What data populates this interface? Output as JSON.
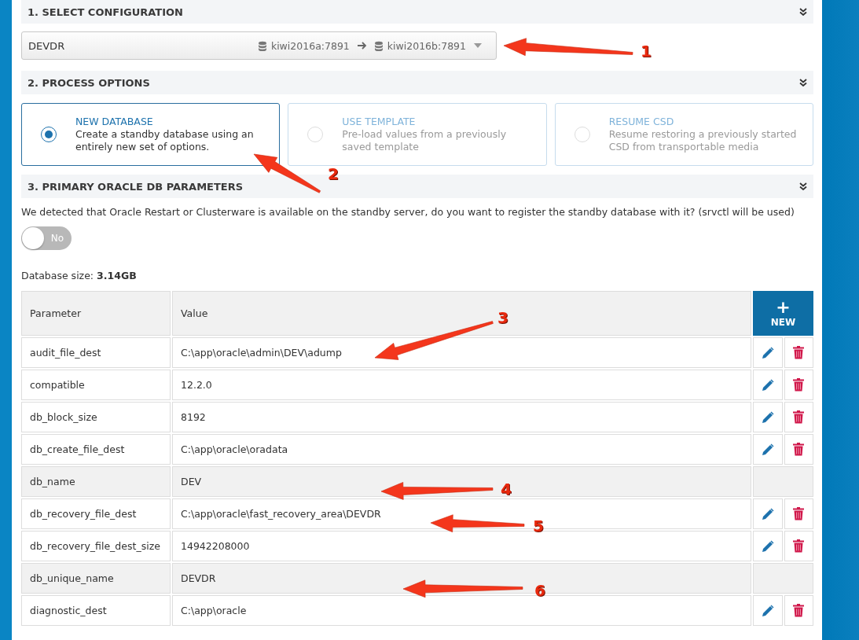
{
  "sections": [
    {
      "title": "1. SELECT CONFIGURATION",
      "expanded": true
    },
    {
      "title": "2. PROCESS OPTIONS",
      "expanded": true
    },
    {
      "title": "3. PRIMARY ORACLE DB PARAMETERS",
      "expanded": true
    }
  ],
  "configuration": {
    "value": "DEVDR",
    "source": "kiwi2016a:7891",
    "target": "kiwi2016b:7891"
  },
  "options": [
    {
      "title": "NEW DATABASE",
      "description": "Create a standby database using an entirely new set of options.",
      "selected": true,
      "disabled": false
    },
    {
      "title": "USE TEMPLATE",
      "description": "Pre-load values from a previously saved template",
      "selected": false,
      "disabled": true
    },
    {
      "title": "RESUME CSD",
      "description": "Resume restoring a previously started CSD from transportable media",
      "selected": false,
      "disabled": true
    }
  ],
  "clusterware_notice": "We detected that Oracle Restart or Clusterware is available on the standby server, do you want to register the standby database with it? (srvctl will be used)",
  "register_toggle": {
    "label": "No",
    "on": false
  },
  "database_size": {
    "label": "Database size:",
    "value": "3.14GB"
  },
  "table": {
    "columns": [
      "Parameter",
      "Value"
    ],
    "new_button": {
      "icon": "+",
      "label": "NEW"
    },
    "rows": [
      {
        "parameter": "audit_file_dest",
        "value": "C:\\app\\oracle\\admin\\DEV\\adump",
        "editable": true
      },
      {
        "parameter": "compatible",
        "value": "12.2.0",
        "editable": true
      },
      {
        "parameter": "db_block_size",
        "value": "8192",
        "editable": true
      },
      {
        "parameter": "db_create_file_dest",
        "value": "C:\\app\\oracle\\oradata",
        "editable": true
      },
      {
        "parameter": "db_name",
        "value": "DEV",
        "editable": false
      },
      {
        "parameter": "db_recovery_file_dest",
        "value": "C:\\app\\oracle\\fast_recovery_area\\DEVDR",
        "editable": true
      },
      {
        "parameter": "db_recovery_file_dest_size",
        "value": "14942208000",
        "editable": true
      },
      {
        "parameter": "db_unique_name",
        "value": "DEVDR",
        "editable": false
      },
      {
        "parameter": "diagnostic_dest",
        "value": "C:\\app\\oracle",
        "editable": true
      }
    ]
  },
  "callouts": [
    {
      "label": "1"
    },
    {
      "label": "2"
    },
    {
      "label": "3"
    },
    {
      "label": "4"
    },
    {
      "label": "5"
    },
    {
      "label": "6"
    }
  ]
}
